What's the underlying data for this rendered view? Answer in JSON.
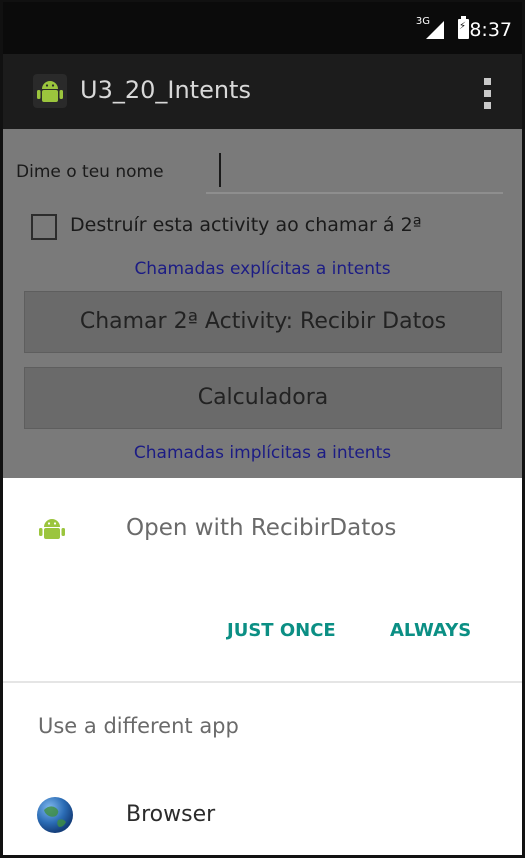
{
  "status_bar": {
    "network": "3G",
    "time": "8:37"
  },
  "action_bar": {
    "title": "U3_20_Intents"
  },
  "form": {
    "name_label": "Dime o teu nome",
    "name_value": "",
    "checkbox_label": "Destruír esta activity ao chamar á 2ª",
    "checkbox_checked": false,
    "explicit_header": "Chamadas explícitas a intents",
    "button_second_activity": "Chamar 2ª Activity: Recibir Datos",
    "button_calculator": "Calculadora",
    "implicit_header": "Chamadas implícitas a intents"
  },
  "chooser": {
    "open_with": "Open with RecibirDatos",
    "just_once": "JUST ONCE",
    "always": "ALWAYS",
    "different_app": "Use a different app",
    "apps": [
      {
        "label": "Browser",
        "icon": "globe-icon"
      }
    ]
  },
  "colors": {
    "accent": "#0b8f84",
    "dim_overlay": "#7a7a7a",
    "link": "#1c1c84"
  }
}
